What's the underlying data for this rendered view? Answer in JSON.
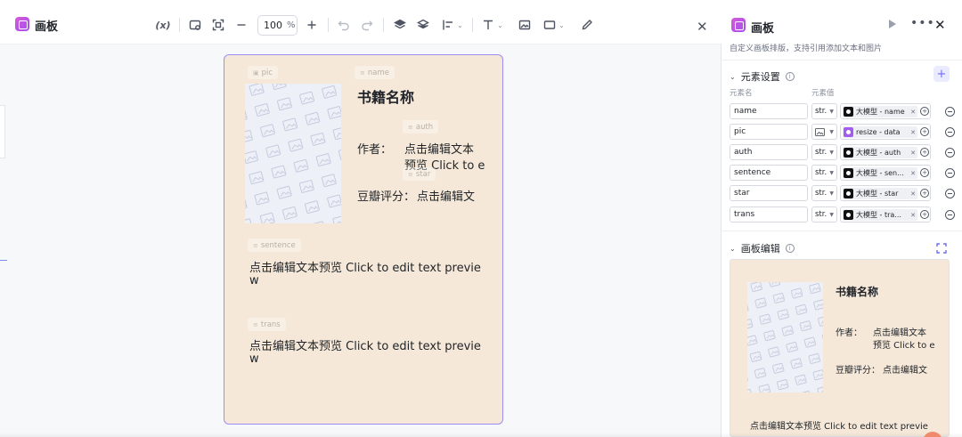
{
  "app": {
    "title": "画板"
  },
  "toolbar": {
    "variable_label": "(x)",
    "zoom_value": "100",
    "zoom_unit": "%"
  },
  "canvas": {
    "tags": {
      "pic": "pic",
      "name": "name",
      "auth": "auth",
      "star": "star",
      "sentence": "sentence",
      "trans": "trans"
    },
    "book_title": "书籍名称",
    "author_label": "作者：",
    "author_value_line1": "点击编辑文本",
    "author_value_line2": "预览 Click to e",
    "rating_label": "豆瓣评分：",
    "rating_value": "点击编辑文",
    "sentence_line1": "点击编辑文本预览 Click to edit text previe",
    "sentence_line2": "w",
    "trans_line1": "点击编辑文本预览 Click to edit text previe",
    "trans_line2": "w"
  },
  "panel": {
    "title": "画板",
    "description": "自定义画板排版，支持引用添加文本和图片",
    "element_settings": {
      "title": "元素设置",
      "col_name": "元素名",
      "col_value": "元素值",
      "rows": [
        {
          "name": "name",
          "type": "str.",
          "value": "大模型 - name",
          "icon": "llm-icon"
        },
        {
          "name": "pic",
          "type": "",
          "value": "resize - data",
          "icon": "resize-icon"
        },
        {
          "name": "auth",
          "type": "str.",
          "value": "大模型 - auth",
          "icon": "llm-icon"
        },
        {
          "name": "sentence",
          "type": "str.",
          "value": "大模型 - sen...",
          "icon": "llm-icon"
        },
        {
          "name": "star",
          "type": "str.",
          "value": "大模型 - star",
          "icon": "llm-icon"
        },
        {
          "name": "trans",
          "type": "str.",
          "value": "大模型 - tra...",
          "icon": "llm-icon"
        }
      ]
    },
    "canvas_edit": {
      "title": "画板编辑",
      "book_title": "书籍名称",
      "author_label": "作者：",
      "author_value_line1": "点击编辑文本",
      "author_value_line2": "预览 Click to e",
      "rating_label": "豆瓣评分：",
      "rating_value": "点击编辑文",
      "sentence_line1": "点击编辑文本预览 Click to edit text previe"
    }
  },
  "colors": {
    "canvas_bg": "#f5e8d8",
    "accent": "#9d8cf5",
    "brand": "#a34df0"
  }
}
